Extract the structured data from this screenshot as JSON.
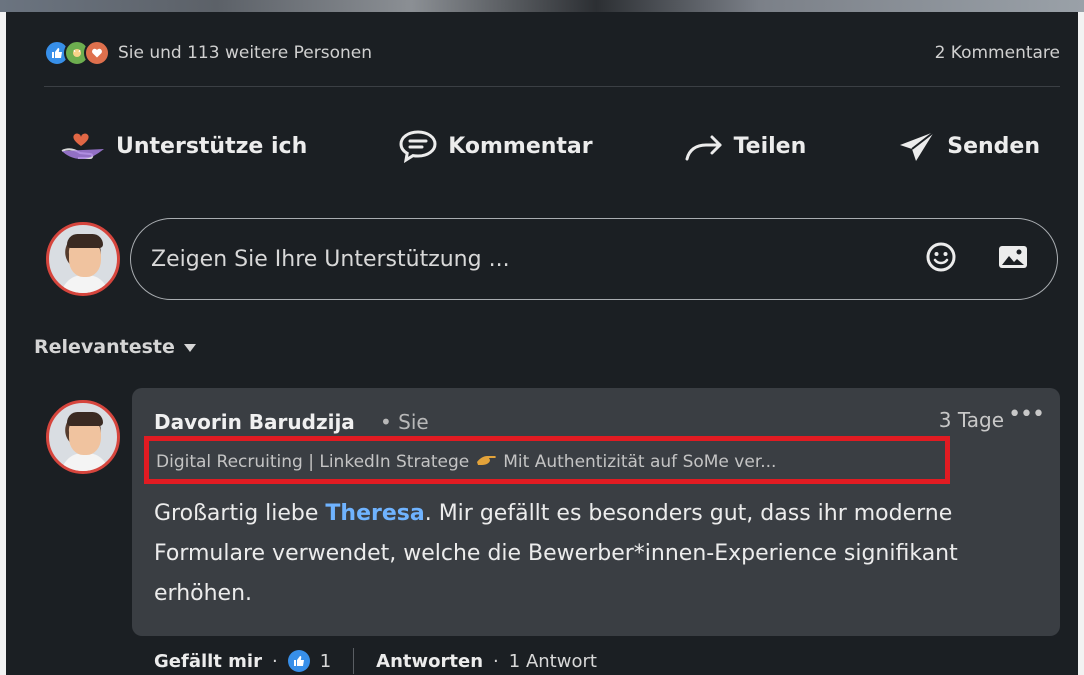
{
  "social": {
    "reactions_text": "Sie und 113 weitere Personen",
    "comments_count": "2 Kommentare",
    "reaction_icons": [
      "like-icon",
      "celebrate-icon",
      "love-icon"
    ]
  },
  "actions": {
    "support": "Unterstütze ich",
    "comment": "Kommentar",
    "share": "Teilen",
    "send": "Senden"
  },
  "composer": {
    "placeholder": "Zeigen Sie Ihre Unterstützung ...",
    "icons": [
      "emoji-icon",
      "image-icon"
    ]
  },
  "sort": {
    "label": "Relevanteste"
  },
  "comment": {
    "author": "Davorin Barudzija",
    "relation": "• Sie",
    "time": "3 Tage",
    "more": "•••",
    "headline_part1": "Digital Recruiting | LinkedIn Stratege",
    "headline_part2": "Mit Authentizität auf SoMe ver...",
    "body_before": "Großartig liebe ",
    "mention": "Theresa",
    "body_after": ". Mir gefällt es besonders gut, dass ihr moderne Formulare verwendet, welche die Bewerber*innen-Experience signifikant erhöhen."
  },
  "comment_actions": {
    "like": "Gefällt mir",
    "sep1": "·",
    "like_count": "1",
    "reply": "Antworten",
    "sep2": "·",
    "replies": "1 Antwort"
  },
  "colors": {
    "background": "#1b1f23",
    "card": "#3a3e43",
    "highlight_box": "#e11b22",
    "link": "#6fb3ff",
    "like_blue": "#378fe9"
  }
}
